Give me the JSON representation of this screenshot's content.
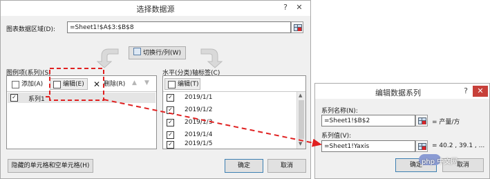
{
  "dialog1": {
    "title": "选择数据源",
    "help": "?",
    "close": "✕",
    "range_label": "图表数据区域(D):",
    "range_value": "=Sheet1!$A$3:$B$8",
    "switch_label": "切换行/列(W)",
    "series_header": "图例项(系列)(S)",
    "add_label": "添加(A)",
    "edit_label": "编辑(E)",
    "delete_label": "删除(R)",
    "up_arrow": "▲",
    "down_arrow": "▼",
    "series_items": [
      "系列1"
    ],
    "axis_header": "水平(分类)轴标签(C)",
    "axis_edit_label": "编辑(T)",
    "axis_items": [
      "2019/1/1",
      "2019/1/2",
      "2019/1/3",
      "2019/1/4",
      "2019/1/5"
    ],
    "hidden_cells_label": "隐藏的单元格和空单元格(H)",
    "ok_label": "确定",
    "cancel_label": "取消"
  },
  "dialog2": {
    "title": "编辑数据系列",
    "help": "?",
    "close": "✕",
    "name_label": "系列名称(N):",
    "name_value": "=Sheet1!$B$2",
    "name_preview": "= 产量/方",
    "values_label": "系列值(V):",
    "values_value": "=Sheet1!Yaxis",
    "values_preview": "= 40.2 , 39.1 , ...",
    "ok_label": "确定",
    "cancel_label": "取消"
  },
  "watermark": "php 中文网",
  "colors": {
    "annotation": "#e02020",
    "close": "#c7403a",
    "dialog_bg": "#f0f0f0"
  }
}
